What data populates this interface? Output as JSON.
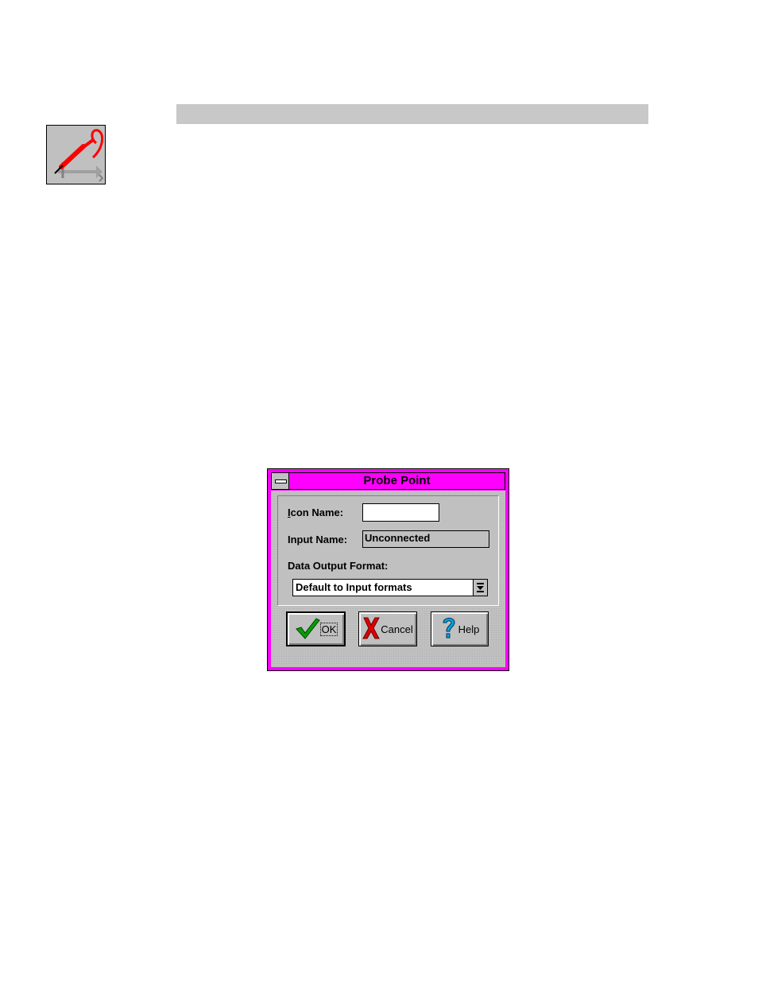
{
  "dialog": {
    "title": "Probe Point",
    "fields": {
      "icon_name_label_prefix": "I",
      "icon_name_label_rest": "con Name:",
      "icon_name_value": "",
      "input_name_label": "Input Name:",
      "input_name_value": "Unconnected",
      "data_output_format_label": "Data Output Format:",
      "data_output_format_value": "Default to Input formats"
    },
    "buttons": {
      "ok": "OK",
      "cancel": "Cancel",
      "help": "Help"
    }
  },
  "icons": {
    "probe": "probe-point-icon",
    "check": "check-icon",
    "x": "cancel-x-icon",
    "question": "help-question-icon",
    "dropdown": "dropdown-arrow-icon"
  },
  "colors": {
    "title_bar": "#ff00ff",
    "dialog_face": "#c0c0c0",
    "probe_red": "#ff0000"
  }
}
